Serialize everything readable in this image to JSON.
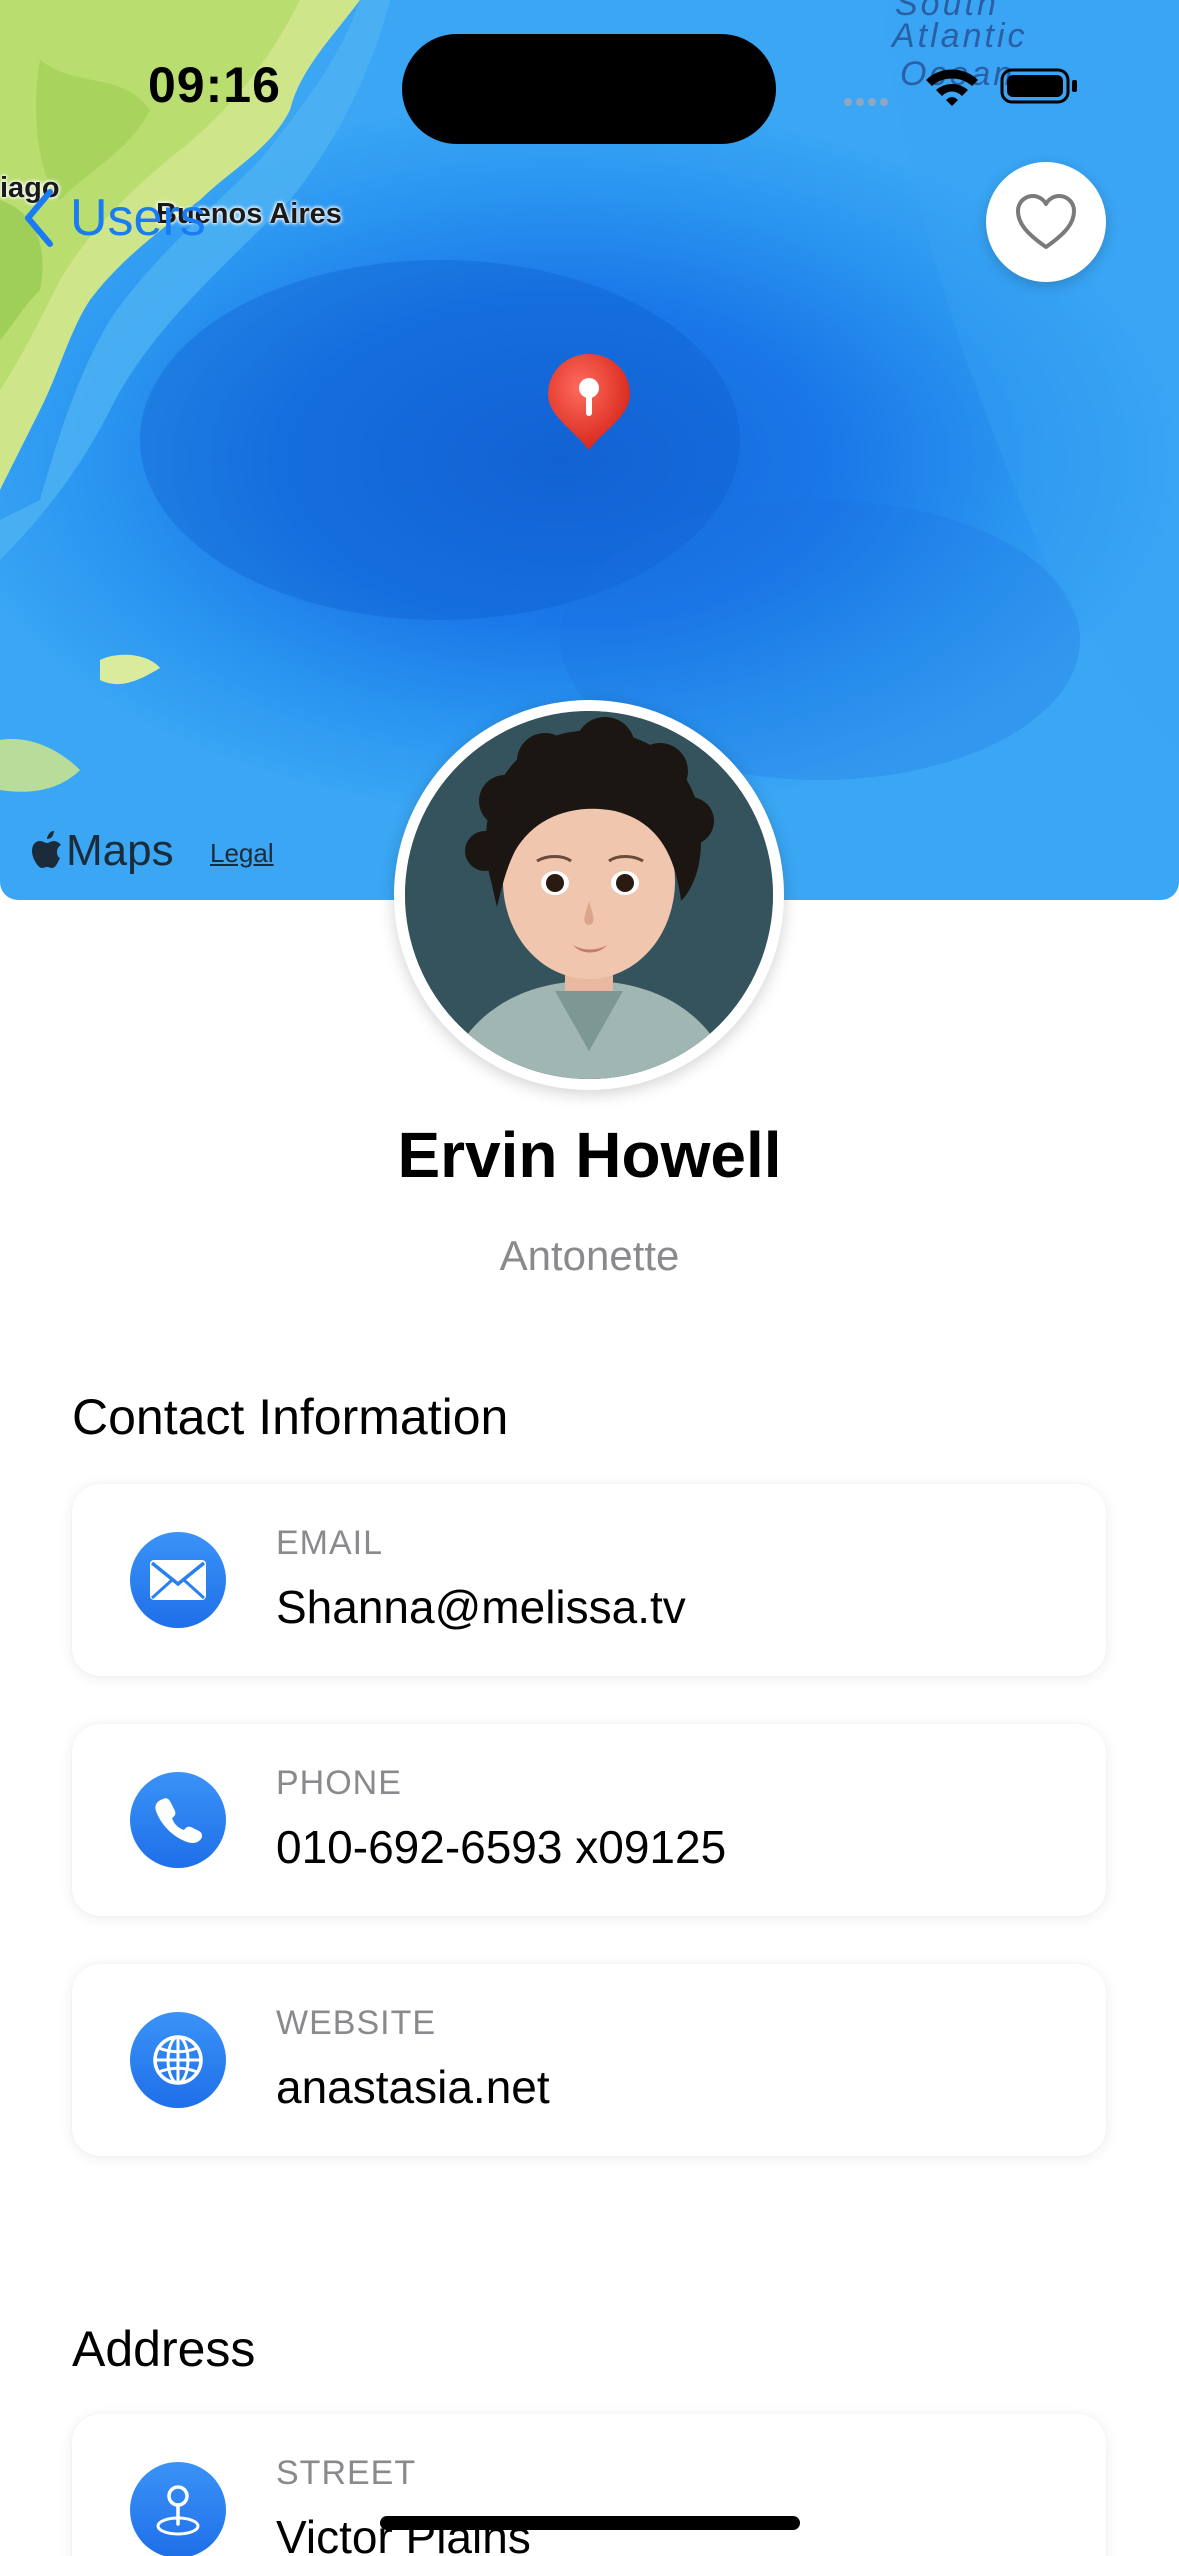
{
  "status_bar": {
    "time": "09:16"
  },
  "map": {
    "labels": {
      "city": "Buenos Aires",
      "partial_city": "iago",
      "ocean": [
        "South",
        "Atlantic",
        "Ocean"
      ]
    },
    "brand": "Maps",
    "legal": "Legal"
  },
  "nav": {
    "back_label": "Users"
  },
  "profile": {
    "name": "Ervin Howell",
    "username": "Antonette"
  },
  "contact": {
    "title": "Contact Information",
    "items": [
      {
        "label": "EMAIL",
        "value": "Shanna@melissa.tv",
        "icon": "envelope-icon"
      },
      {
        "label": "PHONE",
        "value": "010-692-6593 x09125",
        "icon": "phone-icon"
      },
      {
        "label": "WEBSITE",
        "value": "anastasia.net",
        "icon": "globe-icon"
      }
    ]
  },
  "address": {
    "title": "Address",
    "items": [
      {
        "label": "STREET",
        "value": "Victor Plains",
        "icon": "map-pin-icon"
      }
    ]
  },
  "colors": {
    "accent": "#1a7cf5",
    "icon_blue": "#2a80f0",
    "secondary_text": "#8a8a8e",
    "pin_red": "#e53935"
  }
}
